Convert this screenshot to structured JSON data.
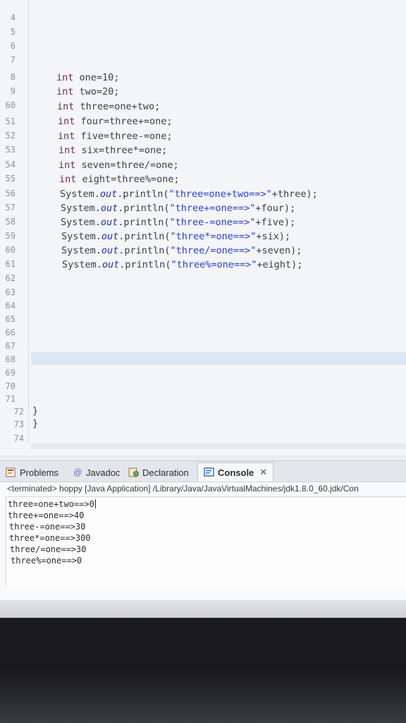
{
  "editor": {
    "line_numbers": [
      "4",
      "5",
      "6",
      "7",
      "8",
      "9",
      "60",
      "51",
      "52",
      "53",
      "54",
      "55",
      "56",
      "57",
      "58",
      "59",
      "60",
      "61",
      "62",
      "63",
      "64",
      "65",
      "66",
      "67",
      "68",
      "69",
      "70",
      "71",
      "72",
      "73",
      "74"
    ],
    "code_lines": [
      {
        "kw": "int",
        "rest": " one=10;"
      },
      {
        "kw": "int",
        "rest": " two=20;"
      },
      {
        "kw": "int",
        "rest": " three=one+two;"
      },
      {
        "kw": "int",
        "rest": " four=three+=one;"
      },
      {
        "kw": "int",
        "rest": " five=three-=one;"
      },
      {
        "kw": "int",
        "rest": " six=three*=one;"
      },
      {
        "kw": "int",
        "rest": " seven=three/=one;"
      },
      {
        "kw": "int",
        "rest": " eight=three%=one;"
      }
    ],
    "print_lines": [
      {
        "pre": "System.",
        "field": "out",
        "mid": ".println(",
        "str": "\"three=one+two==>\"",
        "post": "+three);"
      },
      {
        "pre": "System.",
        "field": "out",
        "mid": ".println(",
        "str": "\"three+=one==>\"",
        "post": "+four);"
      },
      {
        "pre": "System.",
        "field": "out",
        "mid": ".println(",
        "str": "\"three-=one==>\"",
        "post": "+five);"
      },
      {
        "pre": "System.",
        "field": "out",
        "mid": ".println(",
        "str": "\"three*=one==>\"",
        "post": "+six);"
      },
      {
        "pre": "System.",
        "field": "out",
        "mid": ".println(",
        "str": "\"three/=one==>\"",
        "post": "+seven);"
      },
      {
        "pre": "System.",
        "field": "out",
        "mid": ".println(",
        "str": "\"three%=one==>\"",
        "post": "+eight);"
      }
    ],
    "closing_braces": [
      "}",
      "}"
    ]
  },
  "tabs": [
    {
      "label": "Problems",
      "icon": "problems-icon"
    },
    {
      "label": "Javadoc",
      "icon": "javadoc-at-icon"
    },
    {
      "label": "Declaration",
      "icon": "declaration-icon"
    },
    {
      "label": "Console",
      "icon": "console-icon",
      "active": true
    }
  ],
  "console": {
    "status": "<terminated> hoppy [Java Application] /Library/Java/JavaVirtualMachines/jdk1.8.0_60.jdk/Con",
    "output": [
      "three=one+two==>0",
      "three+=one==>40",
      "three-=one==>30",
      "three*=one==>300",
      "three/=one==>30",
      "three%=one==>0"
    ]
  },
  "colors": {
    "keyword": "#6b2a59",
    "string": "#2a3fcc",
    "field": "#1c32a8",
    "console_icon": "#3b6fc4"
  }
}
